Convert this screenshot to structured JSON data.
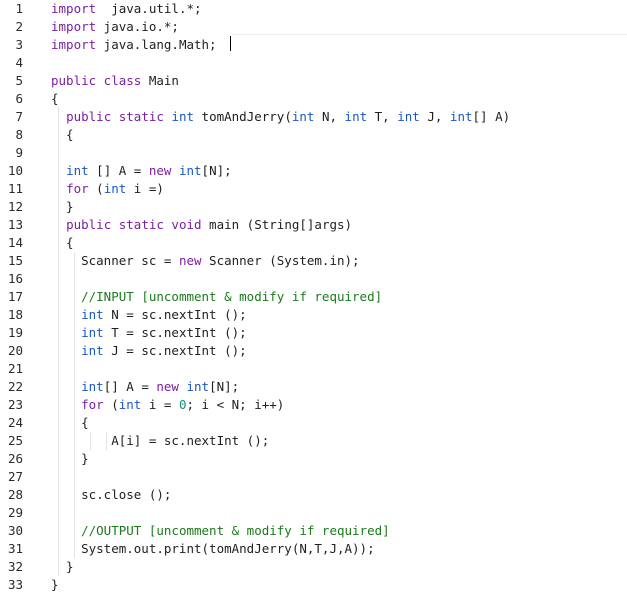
{
  "editor": {
    "lines": [
      {
        "n": "1",
        "t": [
          [
            "kw",
            "import"
          ],
          [
            "",
            "  java.util.*;"
          ]
        ]
      },
      {
        "n": "2",
        "t": [
          [
            "kw",
            "import"
          ],
          [
            "",
            " java.io.*;"
          ]
        ]
      },
      {
        "n": "3",
        "t": [
          [
            "kw",
            "import"
          ],
          [
            "",
            " java.lang.Math;"
          ]
        ]
      },
      {
        "n": "4",
        "t": []
      },
      {
        "n": "5",
        "t": [
          [
            "kw",
            "public class"
          ],
          [
            "",
            " Main"
          ]
        ]
      },
      {
        "n": "6",
        "t": [
          [
            "",
            "{"
          ]
        ]
      },
      {
        "n": "7",
        "t": [
          [
            "",
            "  "
          ],
          [
            "kw",
            "public static"
          ],
          [
            "",
            " "
          ],
          [
            "ty",
            "int"
          ],
          [
            "",
            " tomAndJerry("
          ],
          [
            "ty",
            "int"
          ],
          [
            "",
            " N, "
          ],
          [
            "ty",
            "int"
          ],
          [
            "",
            " T, "
          ],
          [
            "ty",
            "int"
          ],
          [
            "",
            " J, "
          ],
          [
            "ty",
            "int"
          ],
          [
            "",
            "[] A)"
          ]
        ]
      },
      {
        "n": "8",
        "t": [
          [
            "",
            "  {"
          ]
        ]
      },
      {
        "n": "9",
        "t": []
      },
      {
        "n": "10",
        "t": [
          [
            "",
            "  "
          ],
          [
            "ty",
            "int"
          ],
          [
            "",
            " [] A = "
          ],
          [
            "kw",
            "new"
          ],
          [
            "",
            " "
          ],
          [
            "ty",
            "int"
          ],
          [
            "",
            "[N];"
          ]
        ]
      },
      {
        "n": "11",
        "t": [
          [
            "",
            "  "
          ],
          [
            "kw",
            "for"
          ],
          [
            "",
            " ("
          ],
          [
            "ty",
            "int"
          ],
          [
            "",
            " i =)"
          ]
        ]
      },
      {
        "n": "12",
        "t": [
          [
            "",
            "  }"
          ]
        ]
      },
      {
        "n": "13",
        "t": [
          [
            "",
            "  "
          ],
          [
            "kw",
            "public static void"
          ],
          [
            "",
            " main (String[]args)"
          ]
        ]
      },
      {
        "n": "14",
        "t": [
          [
            "",
            "  {"
          ]
        ]
      },
      {
        "n": "15",
        "t": [
          [
            "",
            "    Scanner sc = "
          ],
          [
            "kw",
            "new"
          ],
          [
            "",
            " Scanner (System.in);"
          ]
        ]
      },
      {
        "n": "16",
        "t": []
      },
      {
        "n": "17",
        "t": [
          [
            "",
            "    "
          ],
          [
            "cm",
            "//INPUT [uncomment & modify if required]"
          ]
        ]
      },
      {
        "n": "18",
        "t": [
          [
            "",
            "    "
          ],
          [
            "ty",
            "int"
          ],
          [
            "",
            " N = sc.nextInt ();"
          ]
        ]
      },
      {
        "n": "19",
        "t": [
          [
            "",
            "    "
          ],
          [
            "ty",
            "int"
          ],
          [
            "",
            " T = sc.nextInt ();"
          ]
        ]
      },
      {
        "n": "20",
        "t": [
          [
            "",
            "    "
          ],
          [
            "ty",
            "int"
          ],
          [
            "",
            " J = sc.nextInt ();"
          ]
        ]
      },
      {
        "n": "21",
        "t": []
      },
      {
        "n": "22",
        "t": [
          [
            "",
            "    "
          ],
          [
            "ty",
            "int"
          ],
          [
            "",
            "[] A = "
          ],
          [
            "kw",
            "new"
          ],
          [
            "",
            " "
          ],
          [
            "ty",
            "int"
          ],
          [
            "",
            "[N];"
          ]
        ]
      },
      {
        "n": "23",
        "t": [
          [
            "",
            "    "
          ],
          [
            "kw",
            "for"
          ],
          [
            "",
            " ("
          ],
          [
            "ty",
            "int"
          ],
          [
            "",
            " i = "
          ],
          [
            "nm",
            "0"
          ],
          [
            "",
            "; i < N; i++)"
          ]
        ]
      },
      {
        "n": "24",
        "t": [
          [
            "",
            "    {"
          ]
        ]
      },
      {
        "n": "25",
        "t": [
          [
            "",
            "        A[i] = sc.nextInt ();"
          ]
        ]
      },
      {
        "n": "26",
        "t": [
          [
            "",
            "    }"
          ]
        ]
      },
      {
        "n": "27",
        "t": []
      },
      {
        "n": "28",
        "t": [
          [
            "",
            "    sc.close ();"
          ]
        ]
      },
      {
        "n": "29",
        "t": []
      },
      {
        "n": "30",
        "t": [
          [
            "",
            "    "
          ],
          [
            "cm",
            "//OUTPUT [uncomment & modify if required]"
          ]
        ]
      },
      {
        "n": "31",
        "t": [
          [
            "",
            "    System.out.print(tomAndJerry(N,T,J,A));"
          ]
        ]
      },
      {
        "n": "32",
        "t": [
          [
            "",
            "  }"
          ]
        ]
      },
      {
        "n": "33",
        "t": [
          [
            "",
            "}"
          ]
        ]
      }
    ]
  }
}
